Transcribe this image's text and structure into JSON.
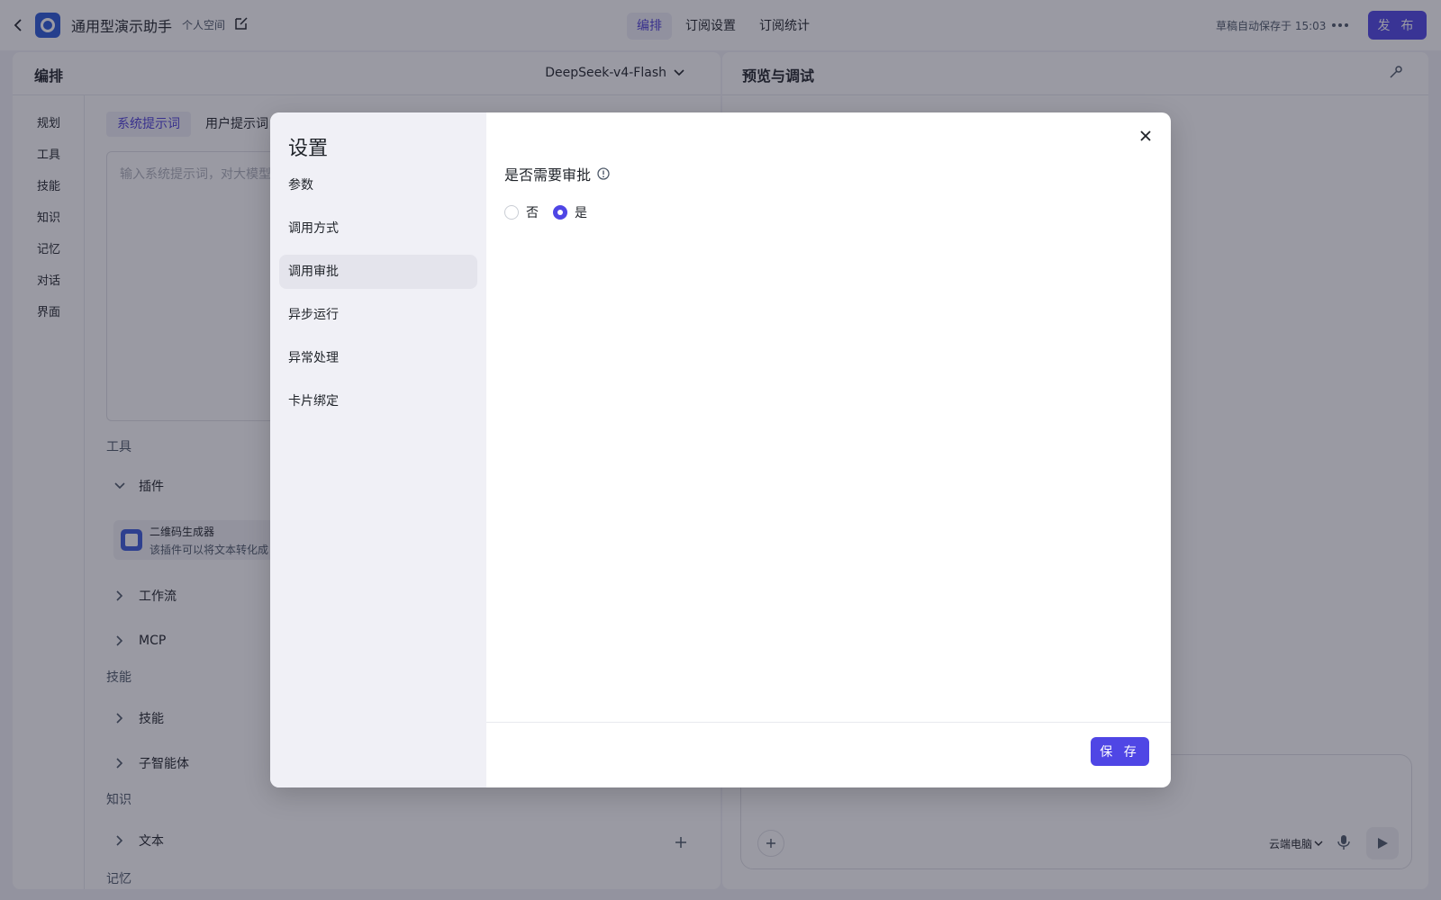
{
  "header": {
    "title": "通用型演示助手",
    "space": "个人空间",
    "tabs": [
      "编排",
      "订阅设置",
      "订阅统计"
    ],
    "active_tab": "编排",
    "saved_text": "草稿自动保存于 15:03",
    "publish_label": "发 布"
  },
  "editor": {
    "title": "编排",
    "model": "DeepSeek-v4-Flash",
    "side_nav": [
      "规划",
      "工具",
      "技能",
      "知识",
      "记忆",
      "对话",
      "界面"
    ],
    "prompt_tabs": [
      "系统提示词",
      "用户提示词"
    ],
    "prompt_placeholder": "输入系统提示词，对大模型",
    "sections": {
      "tools": "工具",
      "skills": "技能",
      "knowledge": "知识",
      "memory": "记忆"
    },
    "groups": {
      "plugins": "插件",
      "workflow": "工作流",
      "mcp": "MCP",
      "skills": "技能",
      "sub_agents": "子智能体",
      "text": "文本"
    },
    "plugin": {
      "name": "二维码生成器",
      "desc": "该插件可以将文本转化成"
    }
  },
  "preview": {
    "title": "预览与调试",
    "cloud_label": "云端电脑"
  },
  "modal": {
    "title": "设置",
    "menu": [
      "参数",
      "调用方式",
      "调用审批",
      "异步运行",
      "异常处理",
      "卡片绑定"
    ],
    "active_menu": "调用审批",
    "field_label": "是否需要审批",
    "options": [
      "否",
      "是"
    ],
    "selected_option": "是",
    "save_label": "保 存"
  },
  "colors": {
    "accent": "#4f46e5",
    "overlay": "rgba(30,32,52,0.45)"
  }
}
